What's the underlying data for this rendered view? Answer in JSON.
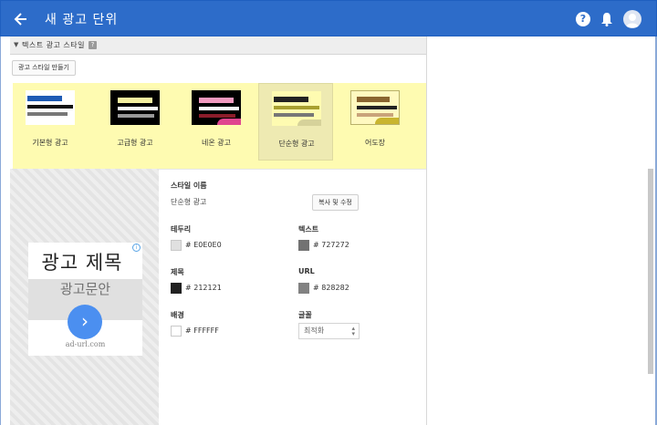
{
  "header": {
    "title": "새 광고 단위"
  },
  "section": {
    "title": "텍스트 광고 스타일",
    "help": "?"
  },
  "create_style_button": "광고 스타일 만들기",
  "styles": [
    {
      "label": "기본형 광고",
      "selected": false
    },
    {
      "label": "고급형 광고",
      "selected": false
    },
    {
      "label": "네온 광고",
      "selected": false
    },
    {
      "label": "단순형 광고",
      "selected": true
    },
    {
      "label": "어도장",
      "selected": false
    }
  ],
  "preview": {
    "ad_title": "광고 제목",
    "ad_text": "광고문안",
    "ad_url": "ad-url.com",
    "info_icon": "i",
    "go_icon": "›"
  },
  "form": {
    "style_name_label": "스타일 이름",
    "style_name_value": "단순형 광고",
    "copy_edit_button": "복사 및 수정",
    "border": {
      "label": "테두리",
      "hex": "# E0E0E0",
      "color": "#E0E0E0"
    },
    "text": {
      "label": "텍스트",
      "hex": "# 727272",
      "color": "#727272"
    },
    "title": {
      "label": "제목",
      "hex": "# 212121",
      "color": "#212121"
    },
    "url": {
      "label": "URL",
      "hex": "# 828282",
      "color": "#828282"
    },
    "background": {
      "label": "배경",
      "hex": "# FFFFFF",
      "color": "#FFFFFF"
    },
    "font": {
      "label": "글꼴",
      "value": "최적화"
    }
  },
  "colors": {
    "appbar": "#2d6cc9",
    "strip": "#fefbb1"
  }
}
